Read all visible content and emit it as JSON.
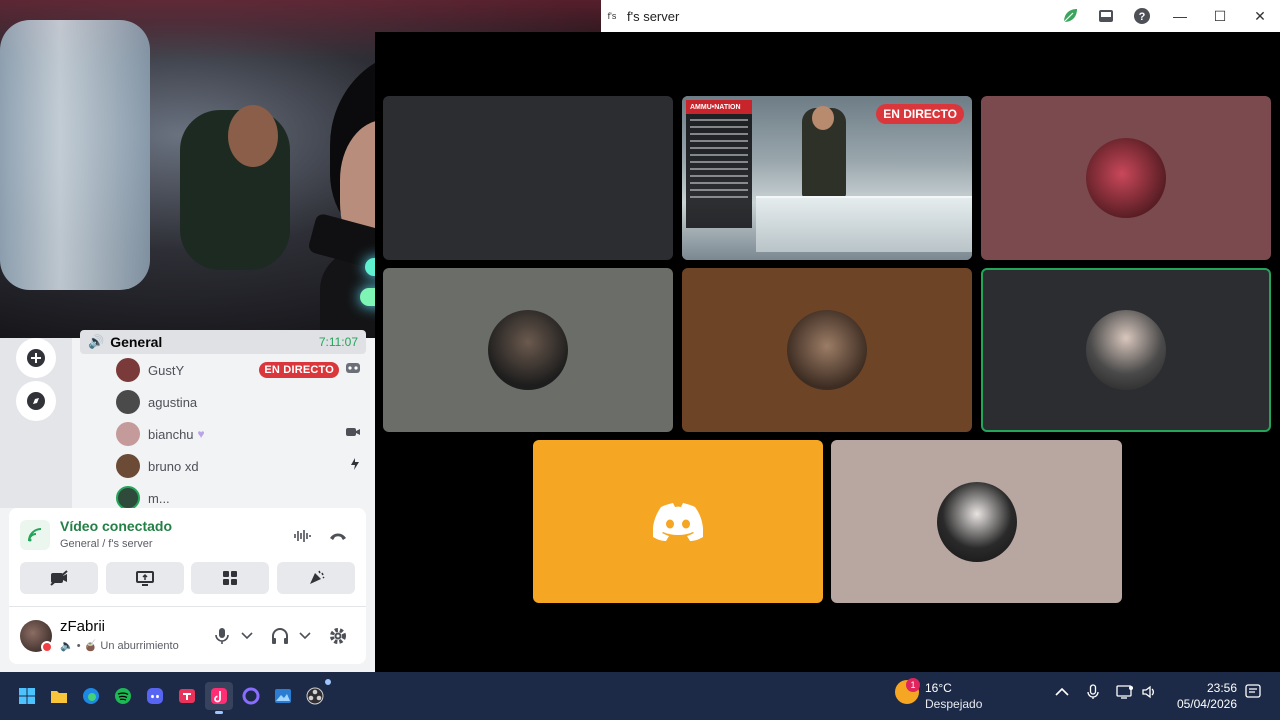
{
  "window": {
    "badge": "f's",
    "title": "f's server"
  },
  "channel": {
    "name": "General",
    "timer": "7:11:07"
  },
  "members": [
    {
      "name": "GustY",
      "live": "EN DIRECTO",
      "avatar_color": "#7a3a3a"
    },
    {
      "name": "agustina",
      "avatar_color": "#4a4a4a"
    },
    {
      "name": "bianchu",
      "avatar_color": "#c49a9a"
    },
    {
      "name": "bruno xd",
      "avatar_color": "#6b4a36"
    },
    {
      "name": "m...",
      "avatar_color": "#2f4a3a"
    }
  ],
  "voice": {
    "status": "Vídeo conectado",
    "location": "General / f's server"
  },
  "user": {
    "name": "zFabrii",
    "activity": "• 🧉 Un aburrimiento"
  },
  "grid": {
    "live_tag": "EN DIRECTO",
    "game_menu_title": "AMMU•NATION"
  },
  "weather": {
    "badge": "1",
    "temp": "16°C",
    "desc": "Despejado"
  },
  "clock": {
    "time": "23:56",
    "date": "05/04/2026"
  },
  "colors": {
    "live_red": "#da373c",
    "connected_green": "#23a55a",
    "discord_tile": "#f5a623",
    "taskbar": "#1c2a47"
  }
}
